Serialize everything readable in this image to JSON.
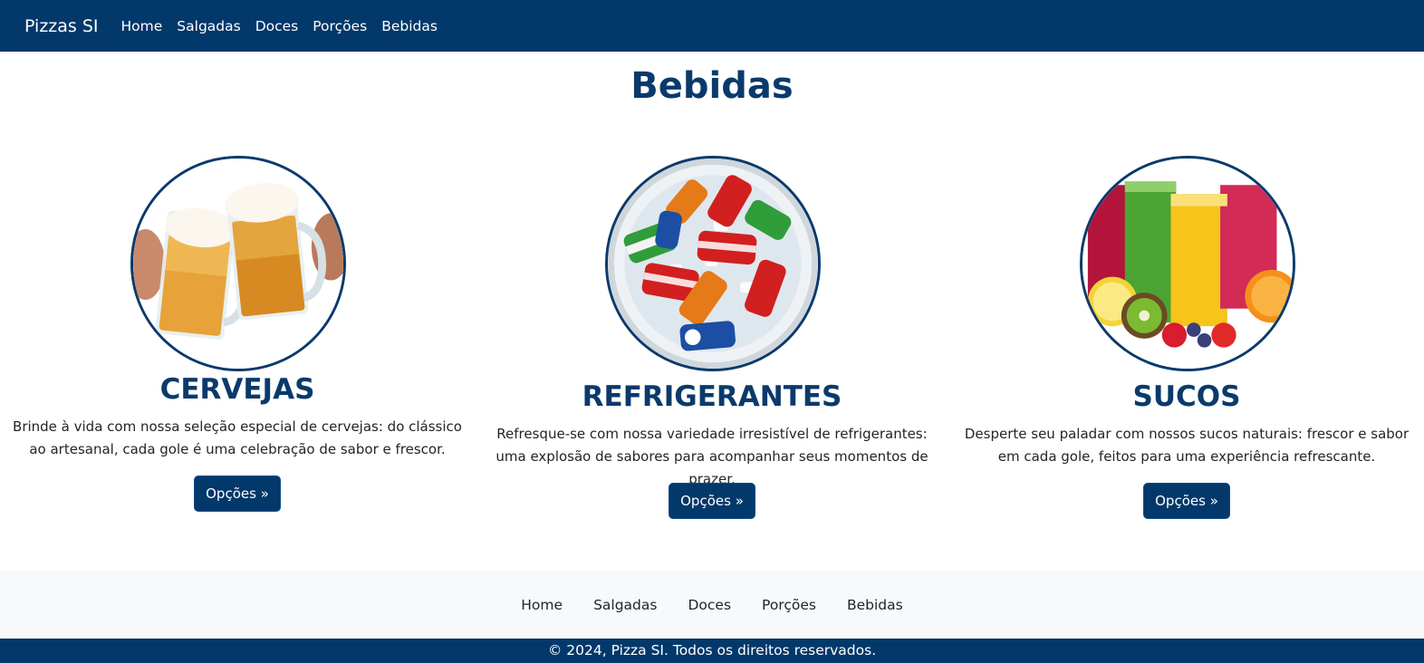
{
  "navbar": {
    "brand": "Pizzas SI",
    "links": [
      "Home",
      "Salgadas",
      "Doces",
      "Porções",
      "Bebidas"
    ]
  },
  "page": {
    "title": "Bebidas"
  },
  "cards": [
    {
      "image": "beer-mugs-image",
      "title": "CERVEJAS",
      "text": "Brinde à vida com nossa seleção especial de cervejas: do clássico ao artesanal, cada gole é uma celebração de sabor e frescor.",
      "button": "Opções »"
    },
    {
      "image": "soda-cans-on-ice-image",
      "title": "REFRIGERANTES",
      "text": "Refresque-se com nossa variedade irresistível de refrigerantes: uma explosão de sabores para acompanhar seus momentos de prazer.",
      "button": "Opções »"
    },
    {
      "image": "juice-glasses-image",
      "title": "SUCOS",
      "text": "Desperte seu paladar com nossos sucos naturais: frescor e sabor em cada gole, feitos para uma experiência refrescante.",
      "button": "Opções »"
    }
  ],
  "footer": {
    "links": [
      "Home",
      "Salgadas",
      "Doces",
      "Porções",
      "Bebidas"
    ],
    "copyright": "© 2024, Pizza SI. Todos os direitos reservados."
  },
  "colors": {
    "primary": "#02386a",
    "heading": "#0a3a6b",
    "footer_bg": "#f8f9fa"
  }
}
